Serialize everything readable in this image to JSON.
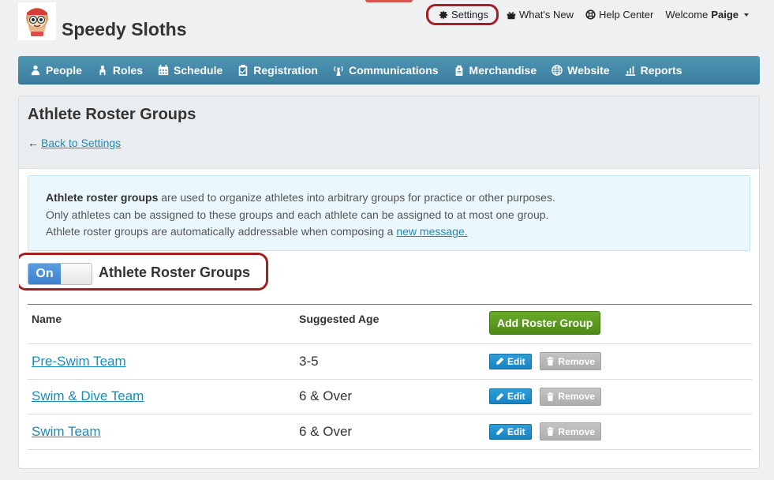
{
  "header": {
    "team_name": "Speedy Sloths",
    "settings_label": "Settings",
    "whats_new_label": "What's New",
    "help_center_label": "Help Center",
    "welcome_text": "Welcome",
    "user_name": "Paige"
  },
  "nav": {
    "items": [
      {
        "label": "People",
        "icon": "person-icon"
      },
      {
        "label": "Roles",
        "icon": "roles-icon"
      },
      {
        "label": "Schedule",
        "icon": "calendar-icon"
      },
      {
        "label": "Registration",
        "icon": "clipboard-icon"
      },
      {
        "label": "Communications",
        "icon": "broadcast-icon"
      },
      {
        "label": "Merchandise",
        "icon": "tag-icon"
      },
      {
        "label": "Website",
        "icon": "globe-icon"
      },
      {
        "label": "Reports",
        "icon": "bar-chart-icon"
      }
    ]
  },
  "page": {
    "title": "Athlete Roster Groups",
    "back_arrow": "←",
    "back_link": "Back to Settings"
  },
  "info": {
    "line1_bold": "Athlete roster groups",
    "line1_rest": " are used to organize athletes into arbitrary groups for practice or other purposes.",
    "line2": "Only athletes can be assigned to these groups and each athlete can be assigned to at most one group.",
    "line3_text": "Athlete roster groups are automatically addressable when composing a ",
    "line3_link": "new message."
  },
  "toggle": {
    "state_label": "On",
    "label": "Athlete Roster Groups"
  },
  "table": {
    "headers": {
      "name": "Name",
      "age": "Suggested Age"
    },
    "add_button": "Add Roster Group",
    "edit_label": "Edit",
    "remove_label": "Remove",
    "rows": [
      {
        "name": "Pre-Swim Team",
        "age": "3-5"
      },
      {
        "name": "Swim & Dive Team",
        "age": "6 & Over"
      },
      {
        "name": "Swim Team",
        "age": "6 & Over"
      }
    ]
  },
  "colors": {
    "nav_bg": "#4389a9",
    "highlight_ring": "#a41f1f",
    "link": "#1a8cb8",
    "add_button": "#5b9a20",
    "edit_button": "#1e90cc",
    "toggle_on": "#4a8fd8"
  }
}
